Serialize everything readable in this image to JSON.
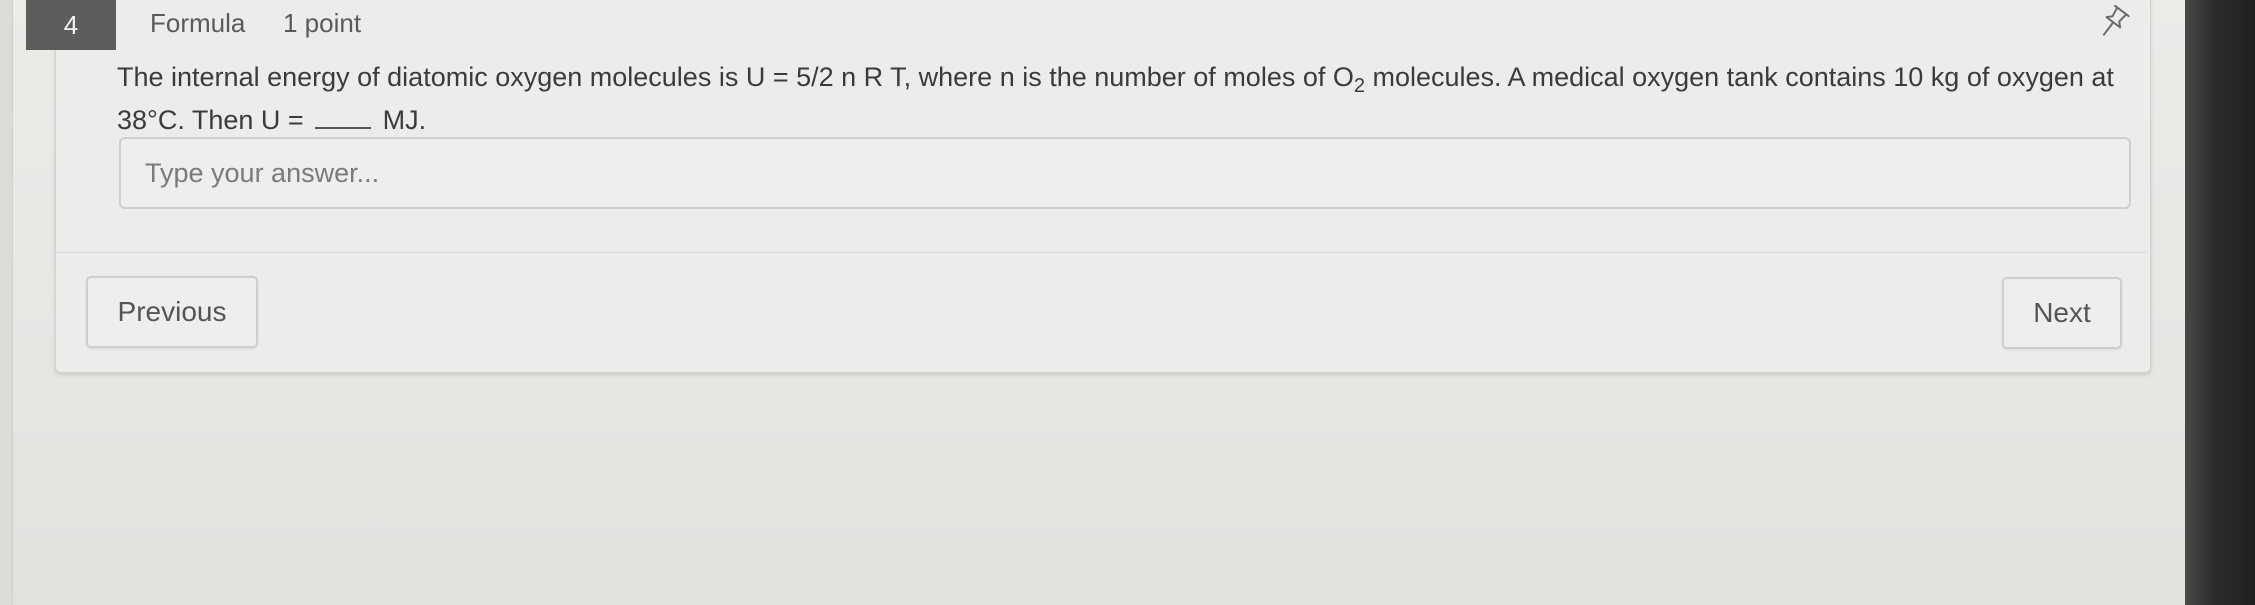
{
  "question": {
    "number": "4",
    "type": "Formula",
    "points": "1 point",
    "text_part1": "The internal energy of diatomic oxygen molecules is U = 5/2 n R T, where n is the number of moles of O",
    "subscript": "2",
    "text_part2": " molecules.  A medical oxygen tank contains 10 kg of oxygen at 38°C.  Then U = ",
    "text_part3": " MJ."
  },
  "answer": {
    "value": "",
    "placeholder": "Type your answer..."
  },
  "navigation": {
    "previous_label": "Previous",
    "next_label": "Next"
  },
  "icons": {
    "pin": "pin-icon"
  },
  "colors": {
    "question_number_bg": "#5d5d5d",
    "card_bg": "#edecea",
    "border": "#cfcecb",
    "text": "#3b3b3b"
  }
}
